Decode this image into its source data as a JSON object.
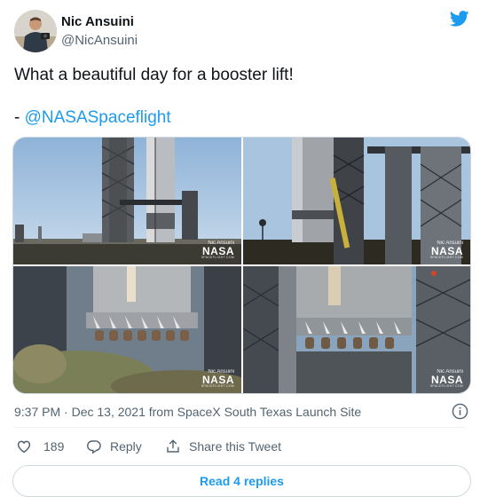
{
  "author": {
    "display_name": "Nic Ansuini",
    "handle": "@NicAnsuini"
  },
  "tweet": {
    "text": "What a beautiful day for a booster lift!",
    "credit_prefix": "- ",
    "credit_mention": "@NASASpaceflight"
  },
  "media": {
    "photos": [
      {
        "watermark_name": "Nic Ansuini",
        "watermark_brand": "NASA",
        "watermark_site": "SPACEFLIGHT.COM"
      },
      {
        "watermark_name": "Nic Ansuini",
        "watermark_brand": "NASA",
        "watermark_site": "SPACEFLIGHT.COM"
      },
      {
        "watermark_name": "Nic Ansuini",
        "watermark_brand": "NASA",
        "watermark_site": "SPACEFLIGHT.COM"
      },
      {
        "watermark_name": "Nic Ansuini",
        "watermark_brand": "NASA",
        "watermark_site": "SPACEFLIGHT.COM"
      }
    ]
  },
  "meta": {
    "timestamp": "9:37 PM · Dec 13, 2021 from SpaceX South Texas Launch Site"
  },
  "actions": {
    "like_count": "189",
    "reply_label": "Reply",
    "share_label": "Share this Tweet"
  },
  "replies_button": "Read 4 replies",
  "colors": {
    "accent": "#1d9bf0",
    "like": "#536471",
    "text_primary": "#0f1419",
    "text_secondary": "#536471"
  },
  "icons": [
    "twitter-bird-icon",
    "info-icon",
    "heart-icon",
    "reply-bubble-icon",
    "share-icon"
  ]
}
